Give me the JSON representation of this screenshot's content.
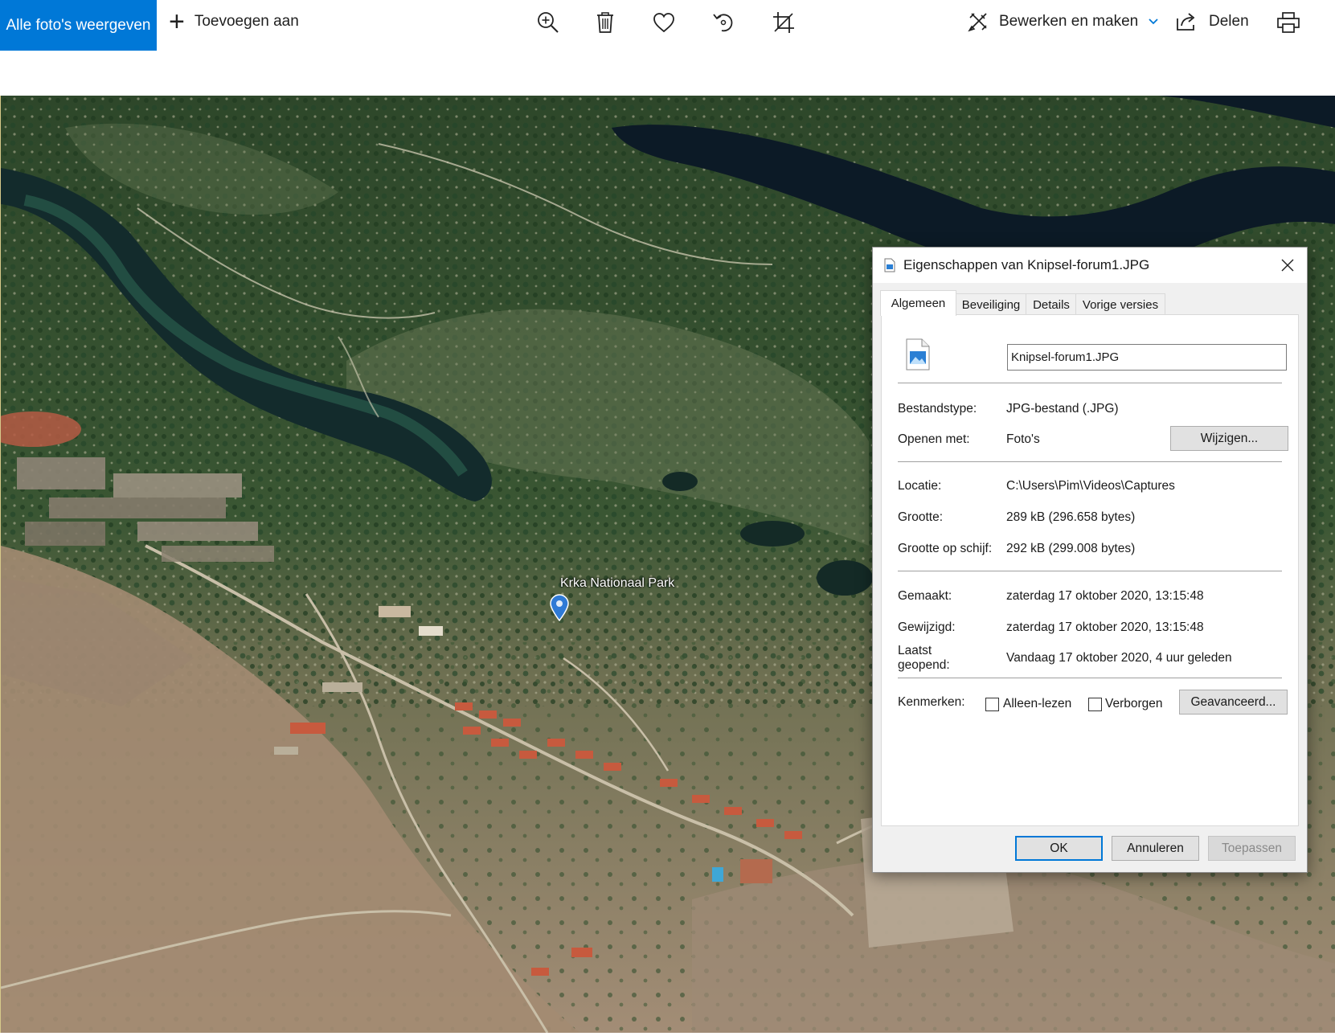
{
  "toolbar": {
    "all_photos_label": "Alle foto's weergeven",
    "add_to_label": "Toevoegen aan",
    "edit_create_label": "Bewerken en maken",
    "share_label": "Delen"
  },
  "photo": {
    "place_label": "Krka Nationaal Park"
  },
  "dialog": {
    "title": "Eigenschappen van Knipsel-forum1.JPG",
    "tabs": [
      "Algemeen",
      "Beveiliging",
      "Details",
      "Vorige versies"
    ],
    "file_name": "Knipsel-forum1.JPG",
    "file_type_label": "Bestandstype:",
    "file_type_value": "JPG-bestand (.JPG)",
    "open_with_label": "Openen met:",
    "open_with_value": "Foto's",
    "change_button": "Wijzigen...",
    "location_label": "Locatie:",
    "location_value": "C:\\Users\\Pim\\Videos\\Captures",
    "size_label": "Grootte:",
    "size_value": "289 kB (296.658 bytes)",
    "size_on_disk_label": "Grootte op schijf:",
    "size_on_disk_value": "292 kB (299.008 bytes)",
    "created_label": "Gemaakt:",
    "created_value": "zaterdag 17 oktober 2020, 13:15:48",
    "modified_label": "Gewijzigd:",
    "modified_value": "zaterdag 17 oktober 2020, 13:15:48",
    "accessed_label_line1": "Laatst",
    "accessed_label_line2": "geopend:",
    "accessed_value": "Vandaag 17 oktober 2020, 4 uur geleden",
    "attributes_label": "Kenmerken:",
    "readonly_label": "Alleen-lezen",
    "hidden_label": "Verborgen",
    "advanced_button": "Geavanceerd...",
    "ok_button": "OK",
    "cancel_button": "Annuleren",
    "apply_button": "Toepassen"
  },
  "colors": {
    "accent": "#0078d7",
    "forest": "#2f4a2a",
    "water": "#0f1f2a",
    "dry_land": "#a8917a"
  }
}
